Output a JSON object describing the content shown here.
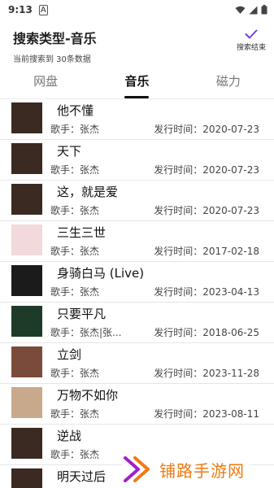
{
  "status": {
    "time": "9:13",
    "a_icon": "A"
  },
  "header": {
    "title": "搜索类型-音乐",
    "subtitle": "当前搜索到 30条数据",
    "done_label": "搜索结束"
  },
  "tabs": [
    {
      "label": "网盘"
    },
    {
      "label": "音乐"
    },
    {
      "label": "磁力"
    }
  ],
  "songs": [
    {
      "title": "他不懂",
      "singer": "歌手：张杰",
      "date": "发行时间：2020-07-23",
      "cover": "#3b2a22"
    },
    {
      "title": "天下",
      "singer": "歌手：张杰",
      "date": "发行时间：2020-07-23",
      "cover": "#3b2a22"
    },
    {
      "title": "这，就是爱",
      "singer": "歌手：张杰",
      "date": "发行时间：2020-07-23",
      "cover": "#3b2a22"
    },
    {
      "title": "三生三世",
      "singer": "歌手：张杰",
      "date": "发行时间：2017-02-18",
      "cover": "#f1d9dc"
    },
    {
      "title": "身骑白马 (Live)",
      "singer": "歌手：张杰",
      "date": "发行时间：2023-04-13",
      "cover": "#1b1b1b"
    },
    {
      "title": "只要平凡",
      "singer": "歌手：张杰|张...",
      "date": "发行时间：2018-06-25",
      "cover": "#1e3b2a"
    },
    {
      "title": "立剑",
      "singer": "歌手：张杰",
      "date": "发行时间：2023-11-28",
      "cover": "#7a4b3a"
    },
    {
      "title": "万物不如你",
      "singer": "歌手：张杰",
      "date": "发行时间：2023-08-11",
      "cover": "#c9a98b"
    },
    {
      "title": "逆战",
      "singer": "歌手：张杰",
      "date": "",
      "cover": "#3b2a22"
    },
    {
      "title": "明天过后",
      "singer": "",
      "date": "",
      "cover": "#3b2a22"
    }
  ],
  "watermark": {
    "text": "铺路手游网"
  },
  "colors": {
    "accent": "#7b3fd6",
    "watermark": "#f07a10"
  }
}
